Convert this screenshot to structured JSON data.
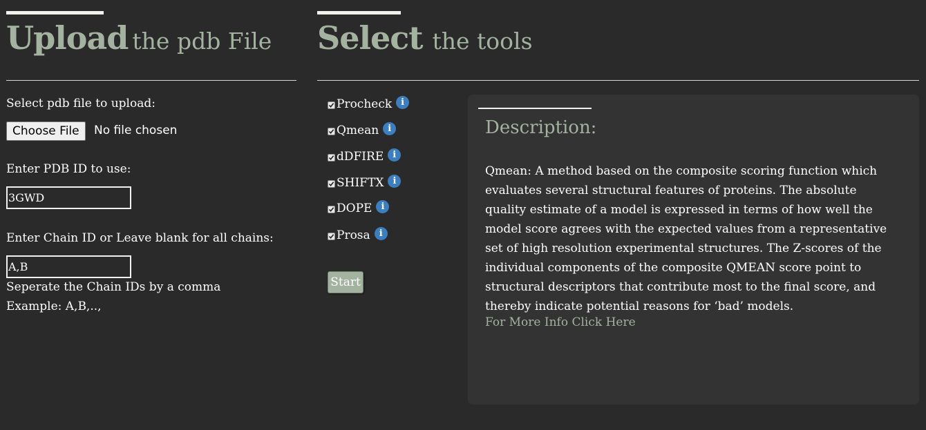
{
  "upload": {
    "title_big": "Upload",
    "title_small": "the pdb File",
    "file_label": "Select pdb file to upload:",
    "file_button": "Choose File",
    "file_status": "No file chosen",
    "pdb_label": "Enter PDB ID to use:",
    "pdb_value": "3GWD",
    "chain_label": "Enter Chain ID or Leave blank for all chains:",
    "chain_value": "A,B",
    "chain_hint": "Seperate the Chain IDs by a comma",
    "chain_example": "Example: A,B,..,"
  },
  "tools": {
    "title_big": "Select",
    "title_small": "the tools",
    "items": [
      {
        "label": "Procheck",
        "checked": true,
        "icon": "info-icon"
      },
      {
        "label": "Qmean",
        "checked": true,
        "icon": "info-icon"
      },
      {
        "label": "dDFIRE",
        "checked": true,
        "icon": "info-icon"
      },
      {
        "label": "SHIFTX",
        "checked": true,
        "icon": "info-icon"
      },
      {
        "label": "DOPE",
        "checked": true,
        "icon": "info-icon"
      },
      {
        "label": "Prosa",
        "checked": true,
        "icon": "info-icon"
      }
    ],
    "start_button": "Start"
  },
  "description": {
    "title": "Description:",
    "text": "Qmean: A method based on the composite scoring function which evaluates several structural features of proteins. The absolute quality estimate of a model is expressed in terms of how well the model score agrees with the expected values from a representative set of high resolution experimental structures. The Z-scores of the individual components of the composite QMEAN score point to structural descriptors that contribute most to the final score, and thereby indicate potential reasons for ‘bad’ models.",
    "link": "For More Info Click Here"
  },
  "colors": {
    "background": "#2a2a2a",
    "panel": "#333333",
    "accent_green": "#a3b3a0",
    "info_blue": "#3d7ebf"
  }
}
